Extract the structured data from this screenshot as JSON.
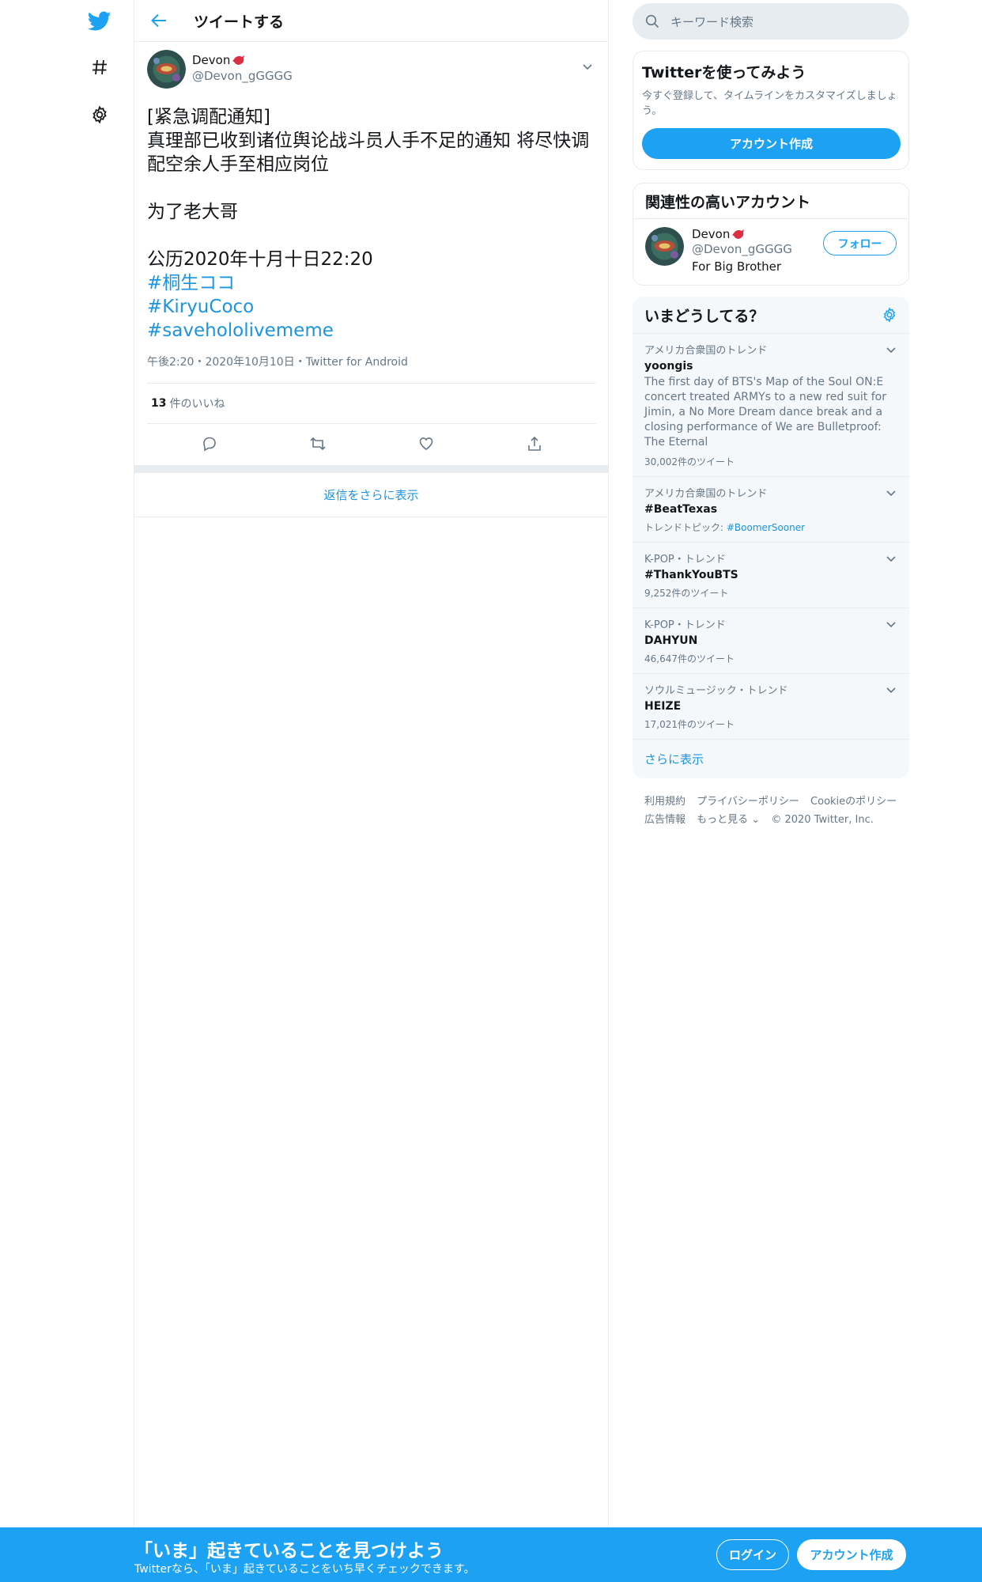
{
  "colors": {
    "accent": "#1da1f2",
    "link": "#1b95e0",
    "muted": "#657786",
    "border": "#e6ecf0"
  },
  "nav": {
    "icons": [
      "twitter-logo-icon",
      "hashtag-icon",
      "gear-icon"
    ]
  },
  "header": {
    "title": "ツイートする"
  },
  "tweet": {
    "author_name": "Devon",
    "author_handle": "@Devon_gGGGG",
    "lines": [
      "[紧急调配通知]",
      "真理部已收到诸位舆论战斗员人手不足的通知 将尽快调",
      "配空余人手至相应岗位",
      "",
      "为了老大哥",
      "",
      "公历2020年十月十日22:20"
    ],
    "hashtags": [
      "#桐生ココ",
      "#KiryuCoco",
      "#savehololivememe"
    ],
    "meta": "午後2:20・2020年10月10日・Twitter for Android",
    "likes_count": "13",
    "likes_label": "件のいいね"
  },
  "more_replies": "返信をさらに表示",
  "search": {
    "placeholder": "キーワード検索"
  },
  "signup_card": {
    "title": "Twitterを使ってみよう",
    "subtitle": "今すぐ登録して、タイムラインをカスタマイズしましょう。",
    "button": "アカウント作成"
  },
  "related": {
    "title": "関連性の高いアカウント",
    "user": {
      "name": "Devon",
      "handle": "@Devon_gGGGG",
      "bio": "For Big Brother",
      "follow": "フォロー"
    }
  },
  "trends": {
    "title": "いまどうしてる？",
    "items": [
      {
        "context": "アメリカ合衆国のトレンド",
        "name": "yoongis",
        "desc": "The first day of BTS's Map of the Soul ON:E concert treated ARMYs to a new red suit for Jimin, a No More Dream dance break and a closing performance of We are Bulletproof: The Eternal",
        "count": "30,002件のツイート"
      },
      {
        "context": "アメリカ合衆国のトレンド",
        "name": "#BeatTexas",
        "topic_label": "トレンドトピック: ",
        "topic_link": "#BoomerSooner"
      },
      {
        "context": "K-POP・トレンド",
        "name": "#ThankYouBTS",
        "count": "9,252件のツイート"
      },
      {
        "context": "K-POP・トレンド",
        "name": "DAHYUN",
        "count": "46,647件のツイート"
      },
      {
        "context": "ソウルミュージック・トレンド",
        "name": "HEIZE",
        "count": "17,021件のツイート"
      }
    ],
    "show_more": "さらに表示"
  },
  "footer": {
    "links": [
      "利用規約",
      "プライバシーポリシー",
      "Cookieのポリシー",
      "広告情報",
      "もっと見る ⌄"
    ],
    "copyright": "© 2020 Twitter, Inc."
  },
  "bottom_bar": {
    "title": "「いま」起きていることを見つけよう",
    "subtitle": "Twitterなら、「いま」起きていることをいち早くチェックできます。",
    "login": "ログイン",
    "signup": "アカウント作成"
  }
}
